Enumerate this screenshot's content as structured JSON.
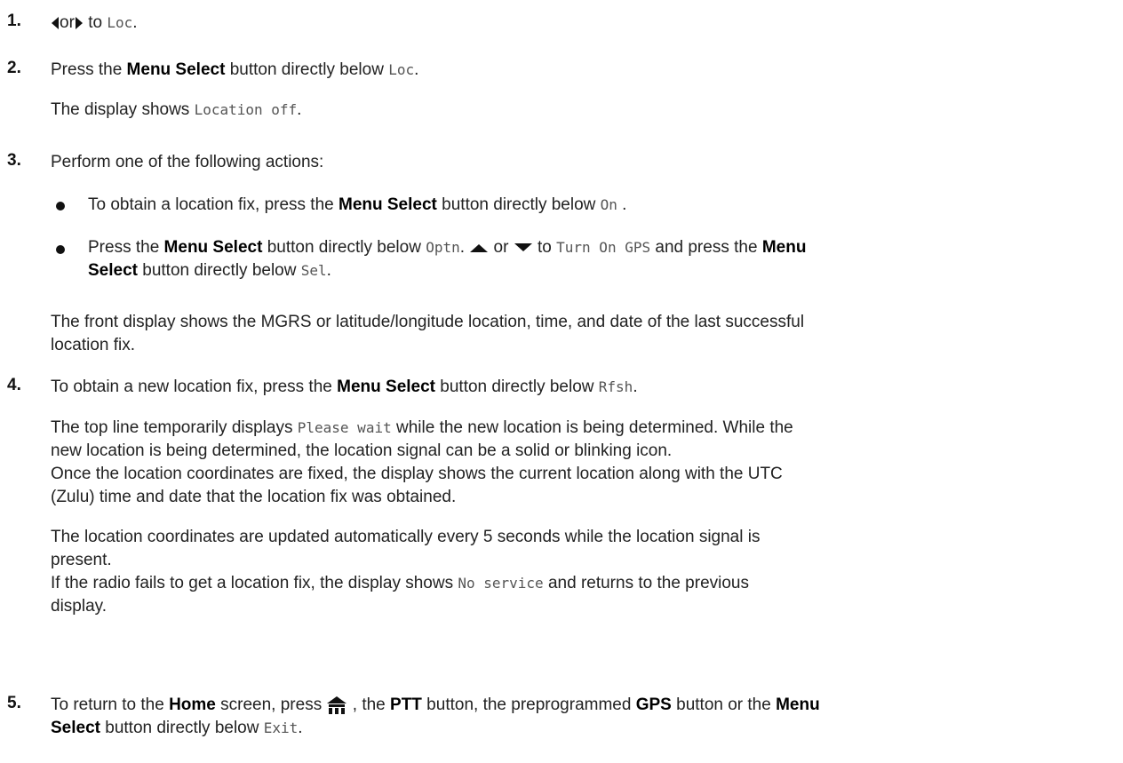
{
  "steps": [
    {
      "num": "1.",
      "parts": {
        "t2": "or",
        "t4": "to ",
        "c5": "Loc",
        "t6": "."
      }
    },
    {
      "num": "2.",
      "line1": {
        "t1": "Press the ",
        "b2": "Menu Select",
        "t3": " button directly below ",
        "c4": "Loc",
        "t5": "."
      },
      "line2": {
        "t1": "The display shows ",
        "c2": "Location off",
        "t3": "."
      }
    },
    {
      "num": "3.",
      "line1": "Perform one of the following actions:",
      "bullet1": {
        "t1": "To obtain a location fix, press the ",
        "b2": "Menu Select",
        "t3": " button directly below ",
        "c4": "On",
        "t5": " ."
      },
      "bullet2": {
        "t1": "Press the ",
        "b2": "Menu Select",
        "t3": " button directly below ",
        "c4": "Optn",
        "t5": ". ",
        "t7": " or ",
        "t9": " to ",
        "c10": "Turn On GPS",
        "t11": " and press the ",
        "b12": "Menu",
        "b13": "Select",
        "t14": " button directly below ",
        "c15": "Sel",
        "t16": "."
      },
      "line2a": "The front display shows the MGRS or latitude/longitude location, time, and date of the last successful",
      "line2b": "location fix."
    },
    {
      "num": "4.",
      "line1": {
        "t1": "To obtain a new location fix, press the ",
        "b2": "Menu Select",
        "t3": " button directly below ",
        "c4": "Rfsh",
        "t5": "."
      },
      "p1": {
        "t1": "The top line temporarily displays ",
        "c2": "Please wait",
        "t3": " while the new location is being determined. While the",
        "t4": "new location is being determined, the location signal can be a solid or blinking icon."
      },
      "p2a": "Once the location coordinates are fixed, the display shows the current location along with the UTC",
      "p2b": "(Zulu) time and date that the location fix was obtained.",
      "p3a": "The location coordinates are updated automatically every 5 seconds while the location signal is",
      "p3b": "present.",
      "p4": {
        "t1": "If the radio fails to get a location fix, the display shows ",
        "c2": "No service",
        "t3": " and returns to the previous",
        "t4": "display."
      }
    },
    {
      "num": "5.",
      "line1": {
        "t1": "To return to the ",
        "b2": "Home",
        "t3": " screen, press ",
        "t5": " , the ",
        "b6": "PTT",
        "t7": " button, the preprogrammed ",
        "b8": "GPS",
        "t9": " button or the ",
        "b10": "Menu",
        "b11": "Select",
        "t12": " button directly below ",
        "c13": "Exit",
        "t14": "."
      }
    }
  ],
  "icons": {
    "left": "left-arrow-icon",
    "right": "right-arrow-icon",
    "up": "up-arrow-icon",
    "down": "down-arrow-icon",
    "home": "home-icon"
  }
}
